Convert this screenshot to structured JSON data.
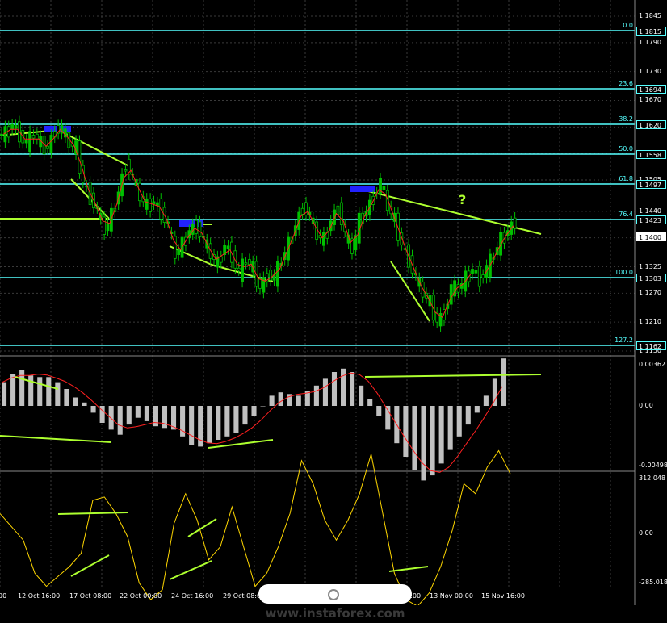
{
  "symbol": "EURUSD",
  "price_axis": [
    "1.1845",
    "1.1790",
    "1.1730",
    "1.1670",
    "1.1615",
    "1.1560",
    "1.1505",
    "1.1440",
    "1.1385",
    "1.1325",
    "1.1270",
    "1.1210",
    "1.1150"
  ],
  "fib_levels": [
    {
      "ratio": "0.0",
      "price": "1.1815"
    },
    {
      "ratio": "23.6",
      "price": "1.1694"
    },
    {
      "ratio": "38.2",
      "price": "1.1620"
    },
    {
      "ratio": "50.0",
      "price": "1.1558"
    },
    {
      "ratio": "61.8",
      "price": "1.1497"
    },
    {
      "ratio": "76.4",
      "price": "1.1423"
    },
    {
      "ratio": "100.0",
      "price": "1.1303"
    },
    {
      "ratio": "127.2",
      "price": "1.1162"
    }
  ],
  "current_price": "1.1400",
  "annotation": "?",
  "macd_axis": {
    "top": "0.00362",
    "mid": "0.00",
    "bottom": "-0.00498"
  },
  "cci_axis": {
    "top": "312.048",
    "mid": "0.00",
    "bottom": "-285.018"
  },
  "time_axis": [
    "00",
    "12 Oct 16:00",
    "17 Oct 08:00",
    "22 Oct 00:00",
    "24 Oct 16:00",
    "29 Oct 08:00",
    "08:00",
    "13 Nov 00:00",
    "15 Nov 16:00"
  ],
  "watermark": "www.instaforex.com",
  "colors": {
    "background": "#000000",
    "grid": "#3a3a3a",
    "fib": "#55ffff",
    "trend": "#adff2f",
    "bull_candle": "#00c000",
    "bear_candle": "#000000",
    "signal": "#ff2020",
    "histogram": "#c0c0c0",
    "cci": "#ffd700",
    "highlight": "#2222ff"
  },
  "chart_data": {
    "type": "candlestick",
    "title": "",
    "ylim": [
      1.112,
      1.188
    ],
    "close_path": [
      1.16,
      1.16,
      1.162,
      1.16,
      1.158,
      1.16,
      1.158,
      1.157,
      1.161,
      1.161,
      1.158,
      1.157,
      1.15,
      1.147,
      1.144,
      1.14,
      1.143,
      1.148,
      1.154,
      1.151,
      1.147,
      1.145,
      1.146,
      1.144,
      1.141,
      1.135,
      1.137,
      1.14,
      1.141,
      1.138,
      1.135,
      1.133,
      1.137,
      1.135,
      1.131,
      1.134,
      1.132,
      1.128,
      1.131,
      1.13,
      1.134,
      1.137,
      1.141,
      1.145,
      1.143,
      1.139,
      1.138,
      1.142,
      1.145,
      1.139,
      1.136,
      1.142,
      1.144,
      1.147,
      1.15,
      1.145,
      1.142,
      1.137,
      1.134,
      1.13,
      1.127,
      1.125,
      1.121,
      1.123,
      1.128,
      1.128,
      1.13,
      1.132,
      1.13,
      1.132,
      1.135,
      1.138,
      1.14,
      1.142
    ],
    "macd_hist": [
      0.0014,
      0.0019,
      0.0021,
      0.0018,
      0.0017,
      0.0017,
      0.0014,
      0.001,
      0.0005,
      0.0002,
      -0.0004,
      -0.001,
      -0.0014,
      -0.0017,
      -0.0011,
      -0.0007,
      -0.0009,
      -0.0012,
      -0.0013,
      -0.0014,
      -0.0018,
      -0.0023,
      -0.0024,
      -0.0022,
      -0.002,
      -0.0018,
      -0.0016,
      -0.0011,
      -0.0006,
      0.0,
      0.0006,
      0.0008,
      0.0007,
      0.0006,
      0.0009,
      0.0012,
      0.0016,
      0.002,
      0.0022,
      0.002,
      0.0012,
      0.0004,
      -0.0006,
      -0.0014,
      -0.0022,
      -0.003,
      -0.0038,
      -0.0044,
      -0.0041,
      -0.0034,
      -0.0026,
      -0.0018,
      -0.0011,
      -0.0004,
      0.0006,
      0.0016,
      0.0028
    ],
    "cci": [
      60,
      20,
      -20,
      -120,
      -160,
      -130,
      -100,
      -60,
      100,
      110,
      60,
      -10,
      -150,
      -200,
      -170,
      30,
      120,
      40,
      -80,
      -40,
      80,
      -40,
      -160,
      -120,
      -40,
      60,
      220,
      150,
      40,
      -20,
      40,
      120,
      240,
      60,
      -120,
      -200,
      -220,
      -180,
      -100,
      10,
      150,
      120,
      200,
      250,
      180
    ]
  }
}
